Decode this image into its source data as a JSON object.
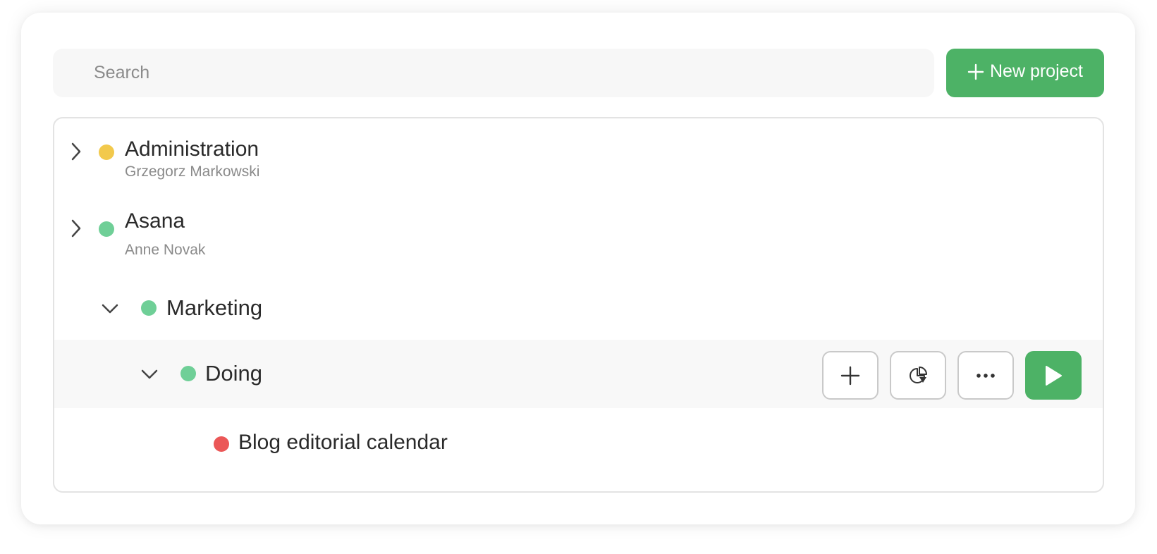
{
  "search": {
    "placeholder": "Search",
    "value": ""
  },
  "toolbar": {
    "new_project_label": "New project",
    "new_project_icon": "plus-icon"
  },
  "colors": {
    "accent": "#4db266",
    "status_yellow": "#f2c94c",
    "status_green": "#6fcf97",
    "status_red": "#eb5757"
  },
  "tree": {
    "items": [
      {
        "name": "Administration",
        "subtitle": "Grzegorz Markowski",
        "status": "yellow",
        "expanded": false
      },
      {
        "name": "Asana",
        "subtitle": "Anne Novak",
        "status": "green",
        "expanded": false
      },
      {
        "name": "Marketing",
        "status": "green",
        "expanded": true
      },
      {
        "name": "Doing",
        "status": "green",
        "expanded": true,
        "highlighted": true
      },
      {
        "name": "Blog editorial calendar",
        "status": "red"
      }
    ]
  },
  "row_actions": [
    "add-icon",
    "pie-chart-icon",
    "more-icon",
    "play-icon"
  ]
}
